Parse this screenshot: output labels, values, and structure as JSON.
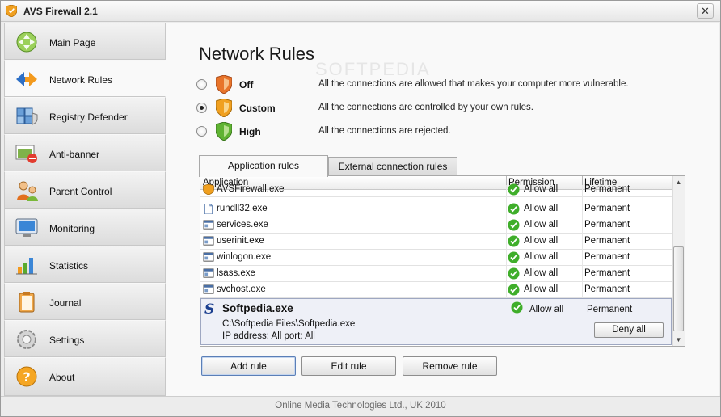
{
  "window": {
    "title": "AVS Firewall 2.1",
    "close_label": "✕"
  },
  "sidebar": {
    "items": [
      {
        "label": "Main Page",
        "icon": "main-page-icon",
        "active": false
      },
      {
        "label": "Network Rules",
        "icon": "network-rules-icon",
        "active": true
      },
      {
        "label": "Registry Defender",
        "icon": "registry-defender-icon",
        "active": false
      },
      {
        "label": "Anti-banner",
        "icon": "anti-banner-icon",
        "active": false
      },
      {
        "label": "Parent Control",
        "icon": "parent-control-icon",
        "active": false
      },
      {
        "label": "Monitoring",
        "icon": "monitoring-icon",
        "active": false
      },
      {
        "label": "Statistics",
        "icon": "statistics-icon",
        "active": false
      },
      {
        "label": "Journal",
        "icon": "journal-icon",
        "active": false
      },
      {
        "label": "Settings",
        "icon": "settings-icon",
        "active": false
      },
      {
        "label": "About",
        "icon": "about-icon",
        "active": false
      }
    ]
  },
  "main": {
    "title": "Network Rules",
    "watermark": "SOFTPEDIA",
    "levels": [
      {
        "name": "Off",
        "description": "All the connections are allowed that makes your computer more vulnerable.",
        "checked": false,
        "color": "#e8742a"
      },
      {
        "name": "Custom",
        "description": "All the connections are controlled  by your own rules.",
        "checked": true,
        "color": "#f0a020"
      },
      {
        "name": "High",
        "description": "All the connections are rejected.",
        "checked": false,
        "color": "#5fb332"
      }
    ],
    "tabs": [
      {
        "label": "Application rules",
        "active": true
      },
      {
        "label": "External connection rules",
        "active": false
      }
    ],
    "grid": {
      "columns": [
        "Application",
        "Permission",
        "Lifetime"
      ],
      "rows": [
        {
          "app": "AVSFirewall.exe",
          "icon": "shield-app-icon",
          "permission": "Allow all",
          "lifetime": "Permanent"
        },
        {
          "app": "rundll32.exe",
          "icon": "file-icon",
          "permission": "Allow all",
          "lifetime": "Permanent"
        },
        {
          "app": "services.exe",
          "icon": "app-window-icon",
          "permission": "Allow all",
          "lifetime": "Permanent"
        },
        {
          "app": "userinit.exe",
          "icon": "app-window-icon",
          "permission": "Allow all",
          "lifetime": "Permanent"
        },
        {
          "app": "winlogon.exe",
          "icon": "app-window-icon",
          "permission": "Allow all",
          "lifetime": "Permanent"
        },
        {
          "app": "lsass.exe",
          "icon": "app-window-icon",
          "permission": "Allow all",
          "lifetime": "Permanent"
        },
        {
          "app": "svchost.exe",
          "icon": "app-window-icon",
          "permission": "Allow all",
          "lifetime": "Permanent"
        }
      ],
      "selected": {
        "logo": "S",
        "name": "Softpedia.exe",
        "path": "C:\\Softpedia Files\\Softpedia.exe",
        "ip": "IP address: All   port: All",
        "permission": "Allow all",
        "lifetime": "Permanent",
        "deny_label": "Deny all"
      }
    },
    "buttons": {
      "add": "Add rule",
      "edit": "Edit rule",
      "remove": "Remove rule"
    }
  },
  "footer": {
    "text": "Online Media Technologies Ltd., UK 2010"
  },
  "colors": {
    "accent": "#5b7fb7",
    "check_green": "#3fae2a",
    "selection": "#eef0f7"
  }
}
